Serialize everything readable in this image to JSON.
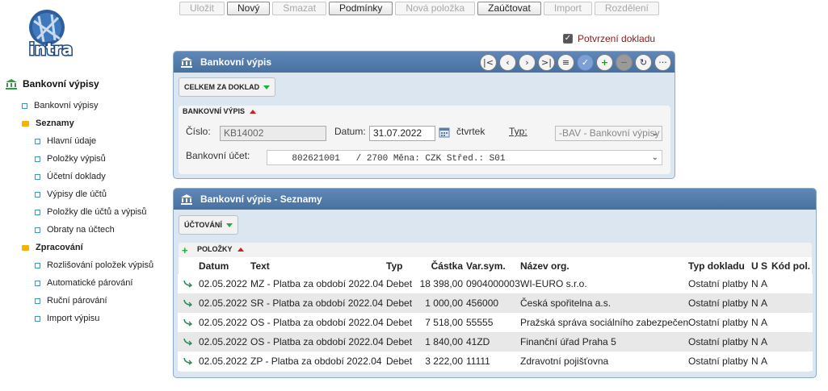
{
  "logo": {
    "text": "intra"
  },
  "toolbar": {
    "buttons": [
      {
        "label": "Uložit",
        "active": false
      },
      {
        "label": "Nový",
        "active": true
      },
      {
        "label": "Smazat",
        "active": false
      },
      {
        "label": "Podmínky",
        "active": true
      },
      {
        "label": "Nová položka",
        "active": false
      },
      {
        "label": "Zaúčtovat",
        "active": true
      },
      {
        "label": "Import",
        "active": false
      },
      {
        "label": "Rozdělení",
        "active": false
      }
    ]
  },
  "confirm": {
    "label": "Potvrzení dokladu",
    "checked": true
  },
  "sidebar": {
    "root": "Bankovní výpisy",
    "item_top": "Bankovní výpisy",
    "folder1": "Seznamy",
    "folder1_items": [
      "Hlavní údaje",
      "Položky výpisů",
      "Účetní doklady",
      "Výpisy dle účtů",
      "Položky dle účtů a výpisů",
      "Obraty na účtech"
    ],
    "folder2": "Zpracování",
    "folder2_items": [
      "Rozlišování položek výpisů",
      "Automatické párování",
      "Ruční párování",
      "Import výpisu"
    ]
  },
  "panel1": {
    "title": "Bankovní výpis",
    "tab": "CELKEM ZA DOKLAD",
    "section": "BANKOVNÍ VÝPIS",
    "cislo_label": "Číslo:",
    "cislo_value": "KB14002",
    "datum_label": "Datum:",
    "datum_value": "31.07.2022",
    "weekday": "čtvrtek",
    "typ_label": "Typ:",
    "typ_value": "-BAV - Bankovní výpisy",
    "ucet_label": "Bankovní účet:",
    "ucet_value": "    802621001   / 2700 Měna: CZK Střed.: S01"
  },
  "panel2": {
    "title": "Bankovní výpis - Seznamy",
    "tab": "ÚČTOVÁNÍ",
    "section": "POLOŽKY"
  },
  "table": {
    "headers": [
      "Datum",
      "Text",
      "Typ",
      "Částka",
      "Var.sym.",
      "Název org.",
      "Typ dokladu",
      "U",
      "S",
      "Kód pol."
    ],
    "rows": [
      [
        "02.05.2022",
        "MZ - Platba za období 2022.04",
        "Debet",
        "18 398,00",
        "0904000003",
        "WI-EURO s.r.o.",
        "Ostatní platby",
        "N",
        "A",
        ""
      ],
      [
        "02.05.2022",
        "SR - Platba za období 2022.04",
        "Debet",
        "1 000,00",
        "456000",
        "Česká spořitelna a.s.",
        "Ostatní platby",
        "N",
        "A",
        ""
      ],
      [
        "02.05.2022",
        "OS - Platba za období 2022.04",
        "Debet",
        "7 518,00",
        "55555",
        "Pražská správa sociálního zabezpečení",
        "Ostatní platby",
        "N",
        "A",
        ""
      ],
      [
        "02.05.2022",
        "OS - Platba za období 2022.04",
        "Debet",
        "1 840,00",
        "41ZD",
        "Finanční úřad Praha 5",
        "Ostatní platby",
        "N",
        "A",
        ""
      ],
      [
        "02.05.2022",
        "ZP - Platba za období 2022.04",
        "Debet",
        "3 222,00",
        "11111",
        "Zdravotní pojišťovna",
        "Ostatní platby",
        "N",
        "A",
        ""
      ]
    ]
  },
  "colors": {
    "header_blue": "#5379a8",
    "panel_bg": "#dce6f0",
    "accent_red": "#cc1f1f",
    "accent_green": "#1fae3c",
    "sidebar_square": "#2a9bd8",
    "folder": "#f5b400"
  }
}
